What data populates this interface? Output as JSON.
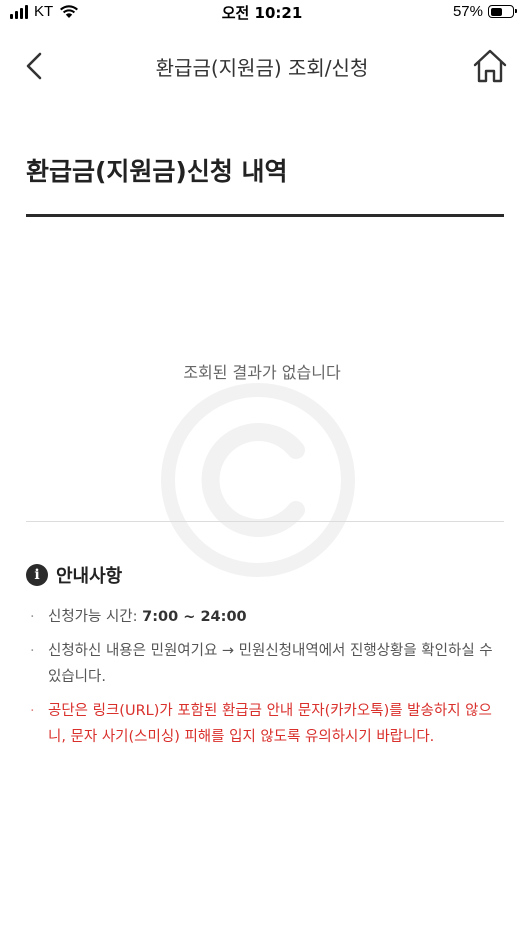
{
  "status_bar": {
    "carrier": "KT",
    "time": "오전 10:21",
    "battery": "57%",
    "battery_level": 0.57
  },
  "header": {
    "title": "환급금(지원금) 조회/신청",
    "back_icon": "chevron-left-icon",
    "home_icon": "home-icon"
  },
  "section": {
    "title": "환급금(지원금)신청 내역"
  },
  "results": {
    "empty_message": "조회된 결과가 없습니다"
  },
  "notice": {
    "title": "안내사항",
    "items": [
      {
        "label": "신청가능 시간: ",
        "value": "7:00 ~ 24:00"
      },
      {
        "text": "신청하신 내용은 민원여기요 → 민원신청내역에서 진행상황을 확인하실 수 있습니다."
      },
      {
        "text": "공단은 링크(URL)가 포함된 환급금 안내 문자(카카오톡)를 발송하지 않으니, 문자 사기(스미싱) 피해를 입지 않도록 유의하시기 바랍니다."
      }
    ],
    "warning_color": "#d9302c"
  }
}
